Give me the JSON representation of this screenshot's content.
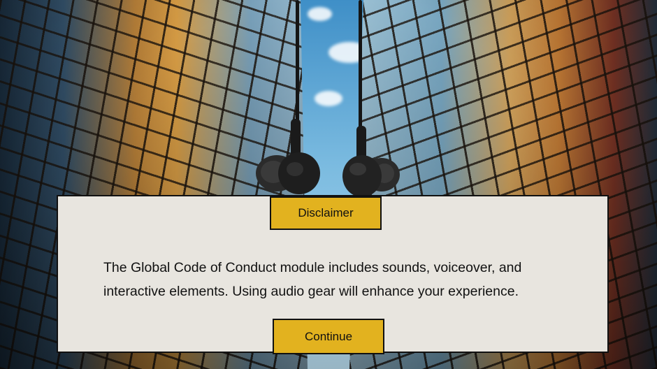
{
  "background": {
    "description_icon": "skyscrapers-headphones-image"
  },
  "dialog": {
    "title": "Disclaimer",
    "message_line1": "The Global Code of Conduct module includes sounds, voiceover, and",
    "message_line2": "interactive elements. Using audio gear will enhance your experience.",
    "continue_label": "Continue"
  },
  "colors": {
    "accent": "#e2b21f",
    "panel": "#e8e5df",
    "border": "#111111"
  }
}
